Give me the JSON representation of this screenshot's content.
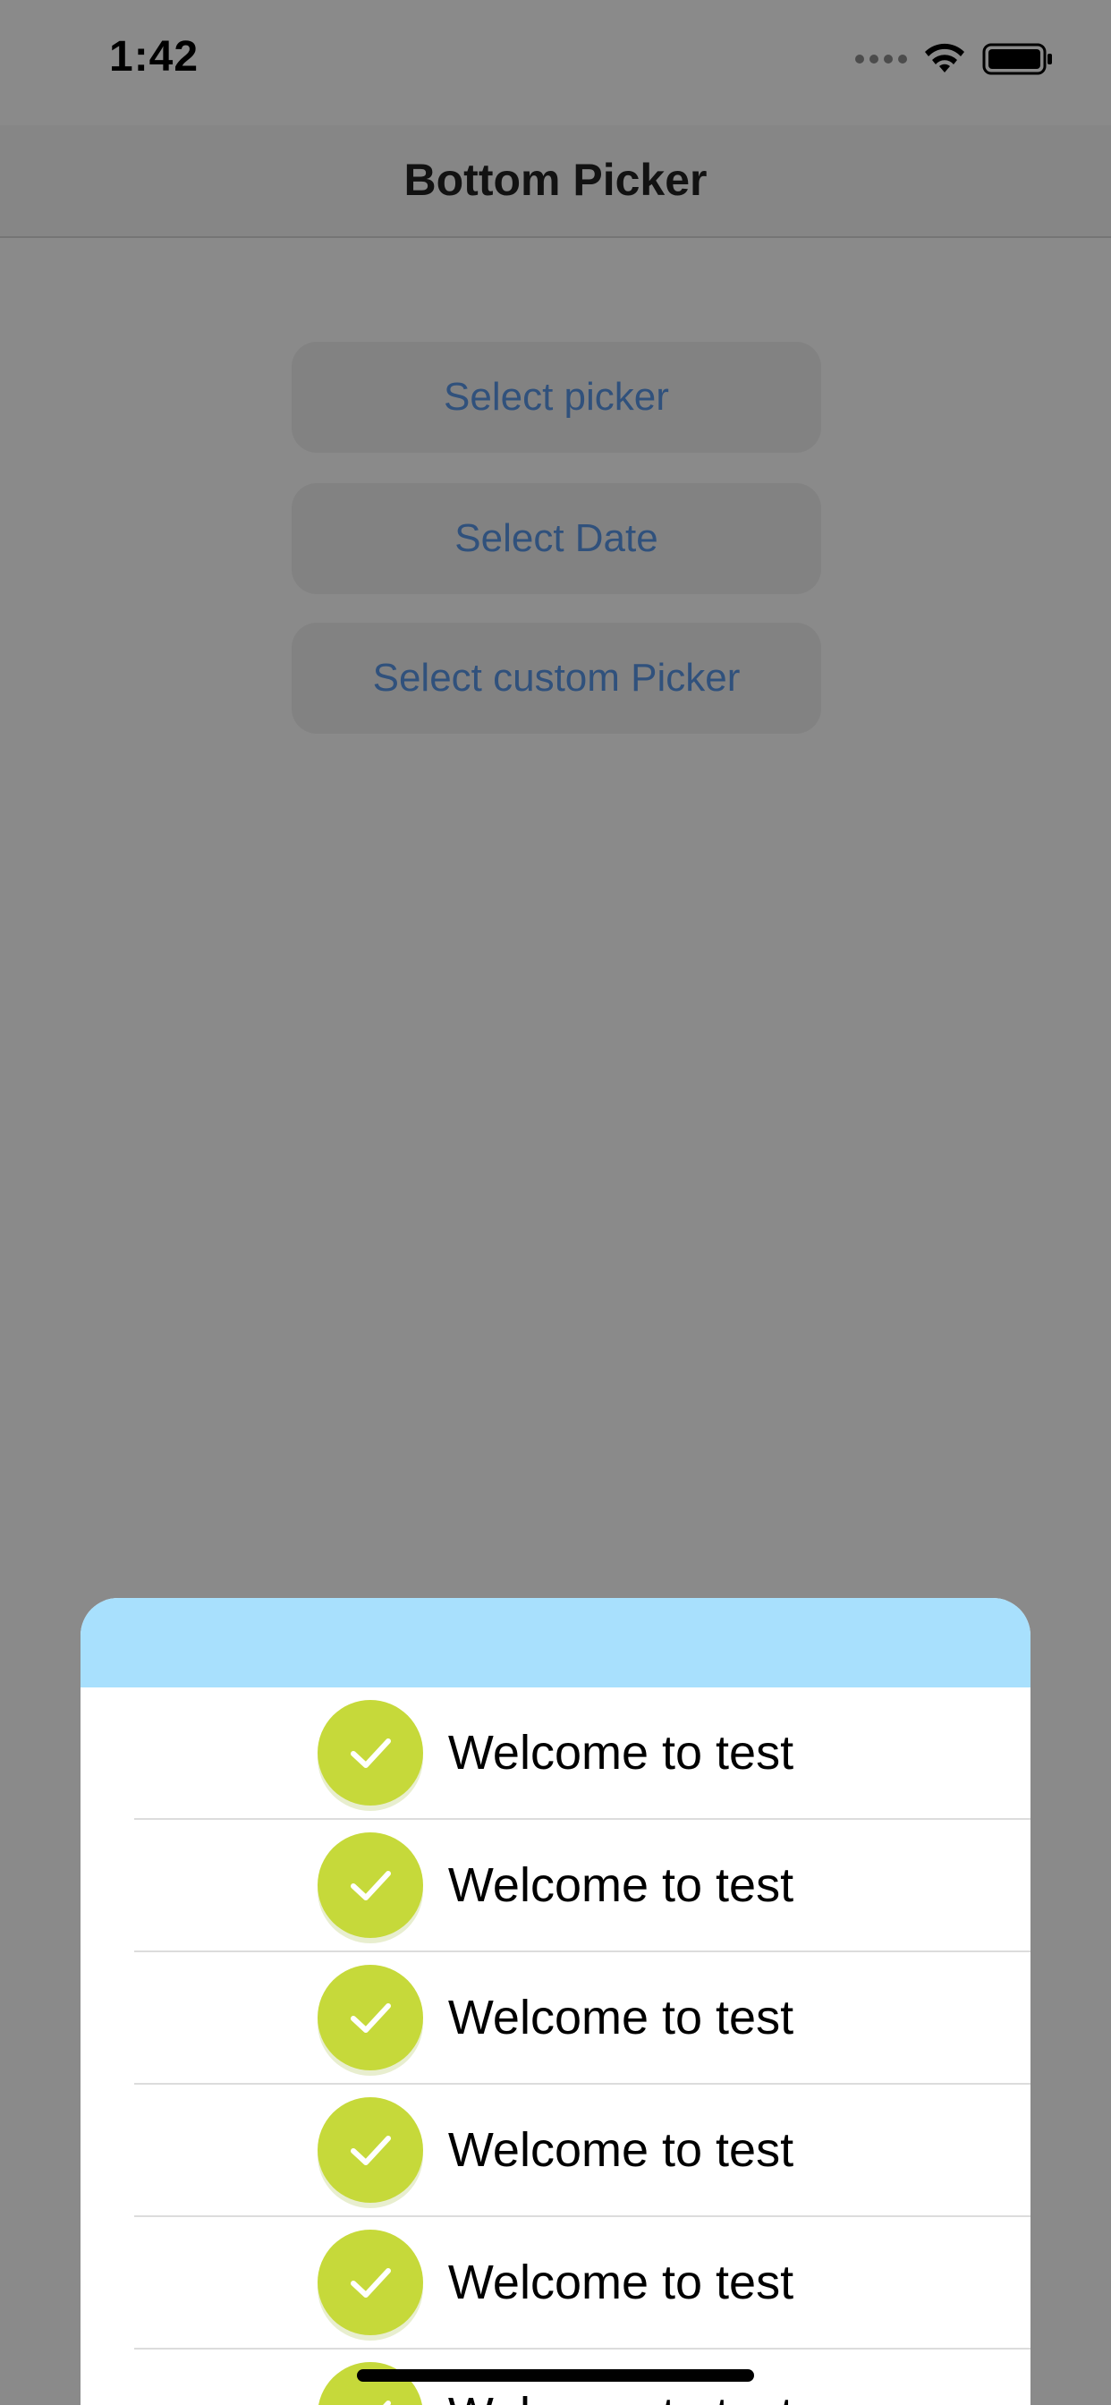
{
  "status_bar": {
    "time": "1:42"
  },
  "nav": {
    "title": "Bottom Picker"
  },
  "buttons": [
    {
      "label": "Select picker"
    },
    {
      "label": "Select Date"
    },
    {
      "label": "Select custom Picker"
    }
  ],
  "sheet": {
    "header_color": "#a8e0fd",
    "items": [
      {
        "label": "Welcome to test"
      },
      {
        "label": "Welcome to test"
      },
      {
        "label": "Welcome to test"
      },
      {
        "label": "Welcome to test"
      },
      {
        "label": "Welcome to test"
      },
      {
        "label": "Welcome to test"
      }
    ]
  },
  "colors": {
    "accent_check": "#c6d93a",
    "button_text": "#5a96e6"
  },
  "icons": {
    "check": "checkmark-icon",
    "wifi": "wifi-icon",
    "battery": "battery-icon",
    "signal": "cellular-signal-icon"
  }
}
